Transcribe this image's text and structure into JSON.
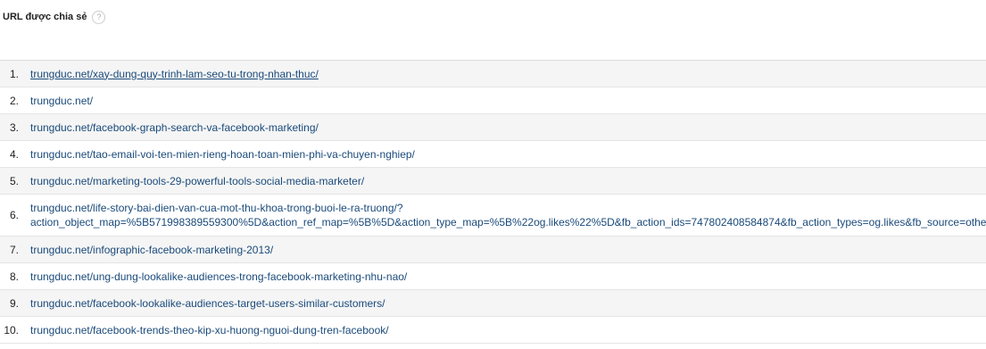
{
  "header": {
    "title": "URL được chia sẻ",
    "help_glyph": "?"
  },
  "rows": [
    {
      "index": "1.",
      "url": "trungduc.net/xay-dung-quy-trinh-lam-seo-tu-trong-nhan-thuc/"
    },
    {
      "index": "2.",
      "url": "trungduc.net/"
    },
    {
      "index": "3.",
      "url": "trungduc.net/facebook-graph-search-va-facebook-marketing/"
    },
    {
      "index": "4.",
      "url": "trungduc.net/tao-email-voi-ten-mien-rieng-hoan-toan-mien-phi-va-chuyen-nghiep/"
    },
    {
      "index": "5.",
      "url": "trungduc.net/marketing-tools-29-powerful-tools-social-media-marketer/"
    },
    {
      "index": "6.",
      "url_line1": "trungduc.net/life-story-bai-dien-van-cua-mot-thu-khoa-trong-buoi-le-ra-truong/?",
      "url_line2": "action_object_map=%5B571998389559300%5D&action_ref_map=%5B%5D&action_type_map=%5B%22og.likes%22%5D&fb_action_ids=747802408584874&fb_action_types=og.likes&fb_source=other_multiline"
    },
    {
      "index": "7.",
      "url": "trungduc.net/infographic-facebook-marketing-2013/"
    },
    {
      "index": "8.",
      "url": "trungduc.net/ung-dung-lookalike-audiences-trong-facebook-marketing-nhu-nao/"
    },
    {
      "index": "9.",
      "url": "trungduc.net/facebook-lookalike-audiences-target-users-similar-customers/"
    },
    {
      "index": "10.",
      "url": "trungduc.net/facebook-trends-theo-kip-xu-huong-nguoi-dung-tren-facebook/"
    }
  ]
}
